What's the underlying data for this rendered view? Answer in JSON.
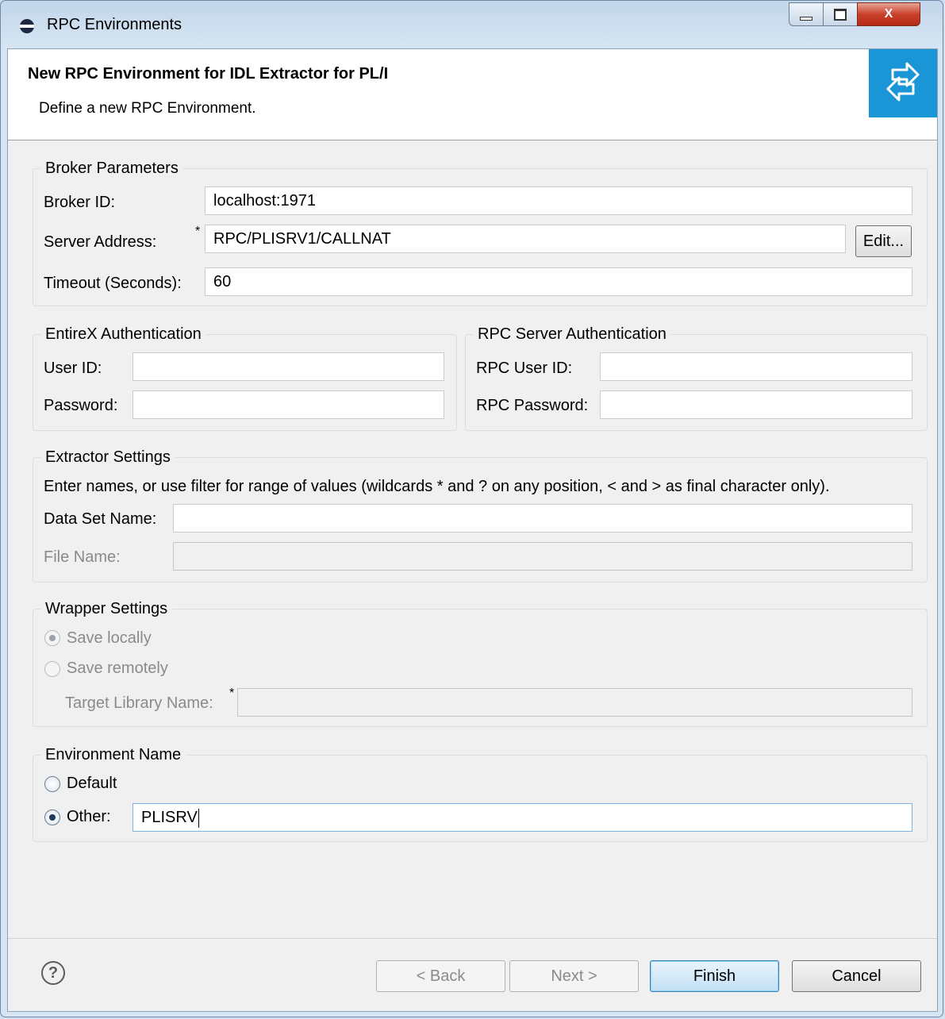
{
  "window": {
    "title": "RPC Environments",
    "close_glyph": "X",
    "icons": {
      "app": "eclipse-app-icon",
      "minimize": "minimize-icon",
      "maximize": "maximize-icon",
      "close": "close-icon"
    }
  },
  "header": {
    "title": "New RPC Environment for IDL Extractor for PL/I",
    "description": "Define a new RPC Environment.",
    "banner_icon": "wizard-arrows-icon",
    "banner_color": "#1a96d6"
  },
  "broker": {
    "group_title": "Broker Parameters",
    "broker_id_label": "Broker ID:",
    "broker_id_value": "localhost:1971",
    "server_address_label": "Server Address:",
    "server_address_required": "*",
    "server_address_value": "RPC/PLISRV1/CALLNAT",
    "edit_button": "Edit...",
    "timeout_label": "Timeout (Seconds):",
    "timeout_value": "60"
  },
  "entirex_auth": {
    "group_title": "EntireX Authentication",
    "user_id_label": "User ID:",
    "user_id_value": "",
    "password_label": "Password:",
    "password_value": ""
  },
  "rpc_auth": {
    "group_title": "RPC Server Authentication",
    "user_id_label": "RPC User ID:",
    "user_id_value": "",
    "password_label": "RPC Password:",
    "password_value": ""
  },
  "extractor": {
    "group_title": "Extractor Settings",
    "hint": "Enter names, or use filter for range of values (wildcards * and ? on any position, < and > as final character only).",
    "data_set_label": "Data Set Name:",
    "data_set_value": "",
    "file_name_label": "File Name:",
    "file_name_value": ""
  },
  "wrapper": {
    "group_title": "Wrapper Settings",
    "save_locally_label": "Save locally",
    "save_locally_checked": true,
    "save_remotely_label": "Save remotely",
    "save_remotely_checked": false,
    "target_library_label": "Target Library Name:",
    "target_library_required": "*",
    "target_library_value": ""
  },
  "env_name": {
    "group_title": "Environment Name",
    "default_label": "Default",
    "default_checked": false,
    "other_label": "Other:",
    "other_checked": true,
    "other_value": "PLISRV"
  },
  "footer": {
    "help_glyph": "?",
    "help_icon": "help-icon",
    "back_button": "< Back",
    "next_button": "Next >",
    "finish_button": "Finish",
    "cancel_button": "Cancel"
  }
}
